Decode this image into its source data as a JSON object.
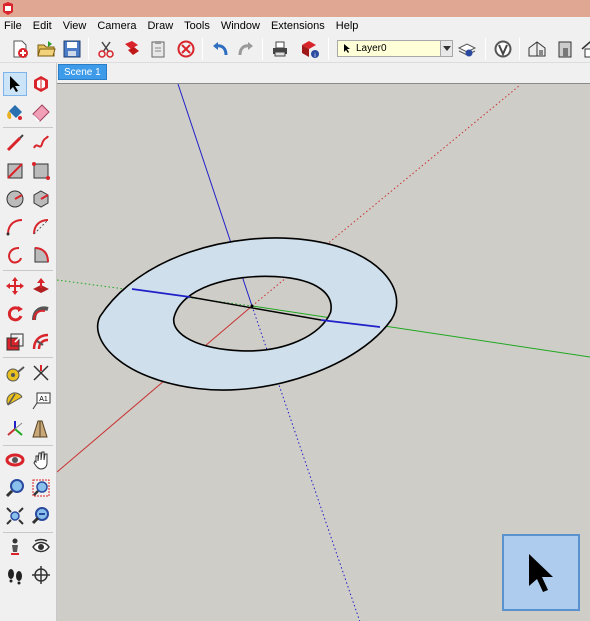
{
  "menu": [
    "File",
    "Edit",
    "View",
    "Camera",
    "Draw",
    "Tools",
    "Window",
    "Extensions",
    "Help"
  ],
  "toolbar": {
    "layer_value": "Layer0",
    "tools": [
      "new-icon",
      "open-icon",
      "save-icon",
      "cut-icon",
      "copy-icon",
      "paste-icon",
      "erase-icon",
      "undo-icon",
      "redo-icon",
      "print-icon",
      "model-info-icon",
      "layer-manager-icon",
      "extension-warehouse-icon",
      "iso-view-icon",
      "front-view-icon",
      "top-view-icon"
    ]
  },
  "scene": {
    "tab_label": "Scene 1"
  },
  "palette": {
    "rows": [
      [
        "select-icon",
        "make-component-icon"
      ],
      [
        "paint-bucket-icon",
        "eraser-icon"
      ],
      [
        "line-icon",
        "freehand-icon"
      ],
      [
        "rectangle-icon",
        "rotated-rectangle-icon"
      ],
      [
        "circle-icon",
        "polygon-icon"
      ],
      [
        "arc-icon",
        "two-point-arc-icon"
      ],
      [
        "three-point-arc-icon",
        "pie-icon"
      ],
      [
        "move-icon",
        "push-pull-icon"
      ],
      [
        "rotate-icon",
        "follow-me-icon"
      ],
      [
        "scale-icon",
        "offset-icon"
      ],
      [
        "tape-measure-icon",
        "dimension-icon"
      ],
      [
        "protractor-icon",
        "text-icon"
      ],
      [
        "axes-icon",
        "3d-text-icon"
      ],
      [
        "orbit-icon",
        "pan-icon"
      ],
      [
        "zoom-icon",
        "zoom-window-icon"
      ],
      [
        "zoom-extents-icon",
        "previous-view-icon"
      ],
      [
        "position-camera-icon",
        "look-around-icon"
      ],
      [
        "walk-icon",
        "section-plane-icon"
      ]
    ]
  },
  "colors": {
    "viewport_bg": "#cfcdc8",
    "face_fill": "#cfdfeb",
    "x_axis": "#c83232",
    "y_axis": "#1fa81f",
    "z_axis": "#2020c8",
    "scene_tab": "#3d9be9",
    "cursor_box": "#aecdee"
  }
}
